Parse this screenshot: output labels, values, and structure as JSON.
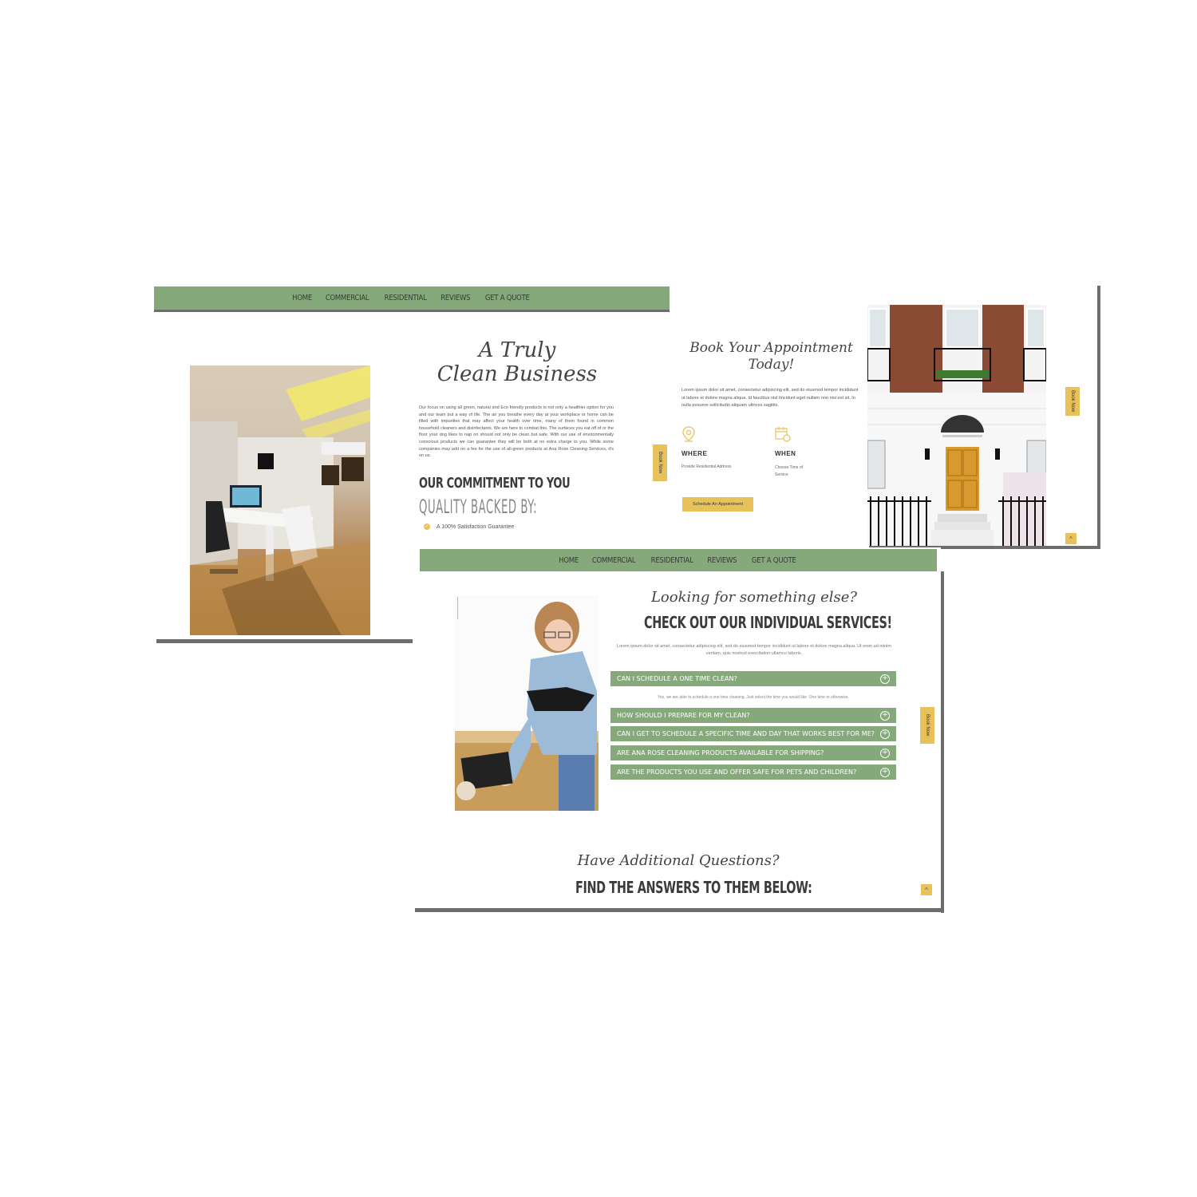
{
  "nav": {
    "items": [
      "Home",
      "Commercial",
      "Residential",
      "Reviews",
      "Get A Quote"
    ]
  },
  "panel1": {
    "heading_line1": "A Truly",
    "heading_line2": "Clean Business",
    "paragraph": "Our focus on using all green, natural and Eco friendly products is not only a healthier option for you and our team but a way of life. The air you breathe every day at your workplace or home can be filled with impurities that may affect your health over time, many of them found in common household cleaners and disinfectants. We are here to combat this. The surfaces you eat off of or the floor your dog likes to nap on should not only be clean but safe. With our use of environmentally conscious products we can guarantee they will be both at no extra charge to you. While some companies may add on a fee for the use of all-green products at Ana Rose Cleaning Services, it's on us.",
    "commitment_title": "OUR COMMITMENT TO YOU",
    "quality_title": "QUALITY BACKED BY:",
    "bullet": "A 100% Satisfaction Guarantee",
    "book_now": "Book Now"
  },
  "panel2": {
    "heading_line1": "Book Your Appointment",
    "heading_line2": "Today!",
    "paragraph": "Lorem ipsum dolor sit amet, consectetur adipiscing elit, sed do eiusmod tempor incididunt ut labore et dolore magna aliqua. Id faucibus nisl tincidunt eget nullam non nisi est sit. In nulla posuere sollicitudin aliquam ultrices sagittis.",
    "where_title": "WHERE",
    "where_text": "Provide Residential Address",
    "when_title": "WHEN",
    "when_text_line1": "Choose Time of",
    "when_text_line2": "Service",
    "cta": "Schedule An Appointment",
    "book_now": "Book Now",
    "scroll_up": "^"
  },
  "panel3": {
    "script_heading": "Looking for something else?",
    "title": "CHECK OUT OUR INDIVIDUAL SERVICES!",
    "paragraph": "Lorem ipsum dolor sit amet, consectetur adipiscing elit, sed do eiusmod tempor incididunt ut labore et dolore magna aliqua. Ut enim ad minim veniam, quis nostrud exercitation ullamco laboris.",
    "faq": [
      "Can I schedule a one time clean?",
      "How should I prepare for my clean?",
      "Can I get to schedule a specific time and day that works best for me?",
      "Are Ana Rose Cleaning products available for shipping?",
      "Are the products you use and offer safe for pets and children?"
    ],
    "faq_answer": "Yes, we are able to schedule a one time cleaning. Just select the time you would like. One time or otherwise.",
    "script_heading2": "Have Additional Questions?",
    "title2": "FIND THE ANSWERS TO THEM BELOW:",
    "book_now": "Book Now",
    "scroll_up": "^"
  },
  "colors": {
    "nav_green": "#86a97c",
    "accent_yellow": "#e7c25b",
    "shadow_gray": "#6d6d6d"
  }
}
